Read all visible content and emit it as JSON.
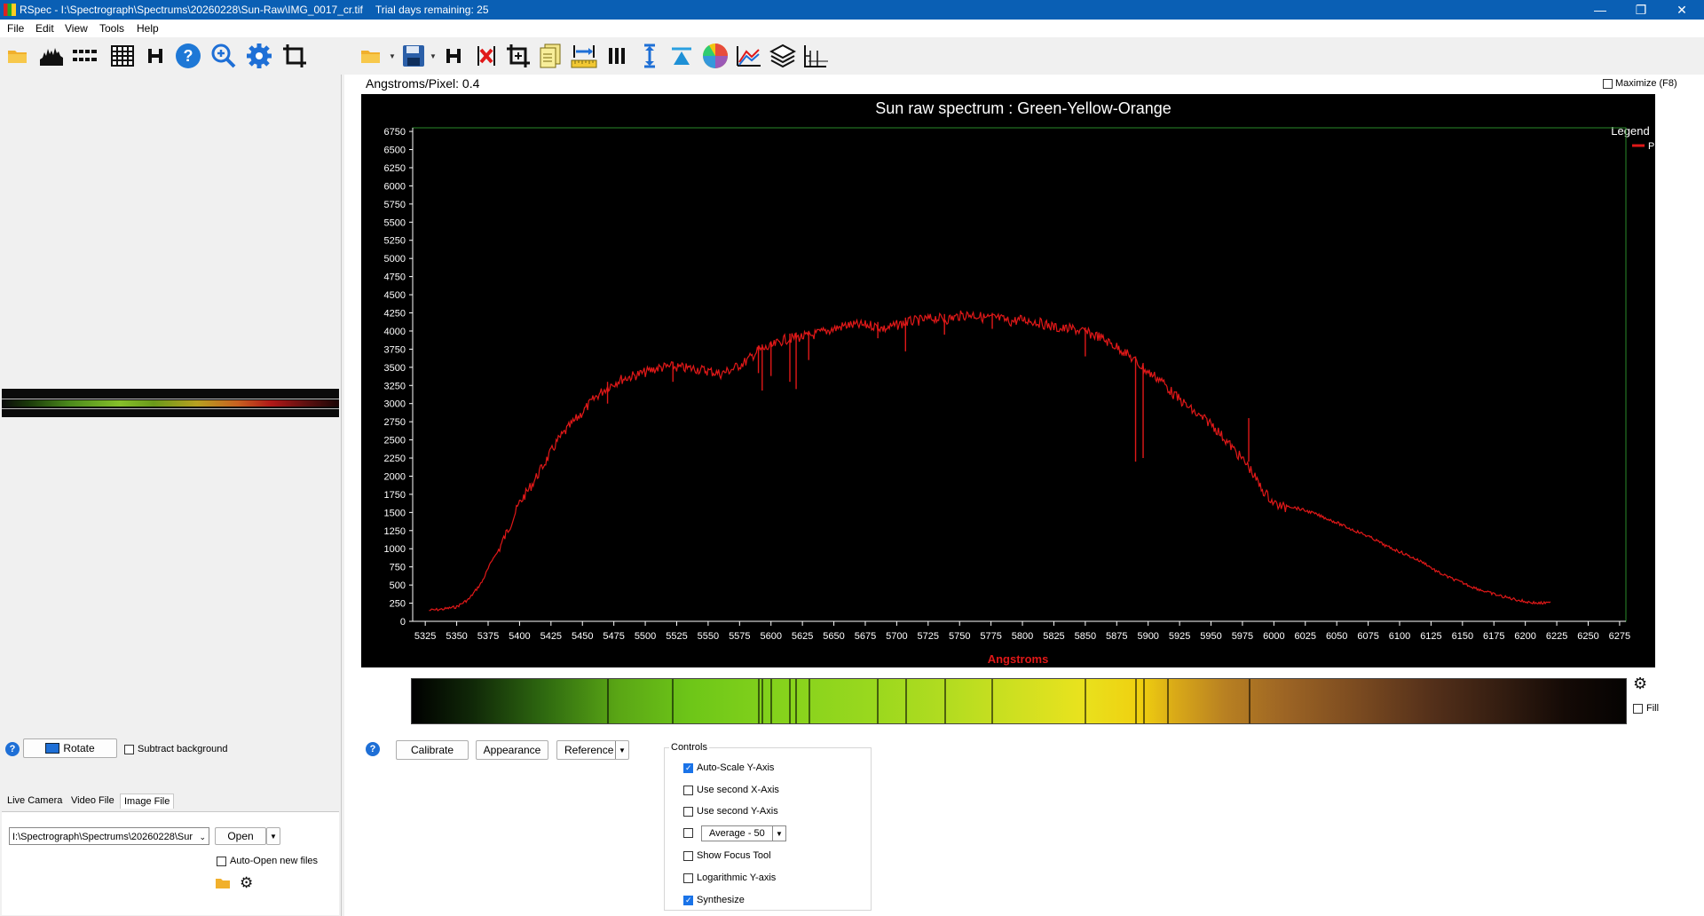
{
  "window": {
    "title": "RSpec - I:\\Spectrograph\\Spectrums\\20260228\\Sun-Raw\\IMG_0017_cr.tif",
    "trial_text": "Trial days remaining: 25",
    "minimize": "—",
    "restore": "❐",
    "close": "✕"
  },
  "menu": [
    "File",
    "Edit",
    "View",
    "Tools",
    "Help"
  ],
  "left_toolbar": [
    "open-folder-icon",
    "histogram-icon",
    "dotted-rows-icon",
    "grid-icon",
    "h-icon",
    "help-icon",
    "zoom-in-icon",
    "gear-icon",
    "crop-icon"
  ],
  "right_toolbar": [
    "open-folder-icon",
    "save-icon",
    "h-icon",
    "close-red-icon",
    "crop-icon",
    "notes-icon",
    "ruler-icon",
    "bars-icon",
    "vertical-measure-icon",
    "triangle-icon",
    "color-wheel-icon",
    "mountains-icon",
    "layers-icon",
    "axis-icon"
  ],
  "info": {
    "angstroms_per_pixel": "Angstroms/Pixel: 0.4",
    "maximize_label": "Maximize (F8)"
  },
  "left_panel": {
    "rotate_label": "Rotate",
    "subtract_background_label": "Subtract background",
    "tabs": [
      "Live Camera",
      "Video File",
      "Image File"
    ],
    "active_tab": "Image File",
    "path_value": "I:\\Spectrograph\\Spectrums\\20260228\\Sur",
    "open_label": "Open",
    "auto_open_label": "Auto-Open new files"
  },
  "bottom": {
    "calibrate_label": "Calibrate",
    "appearance_label": "Appearance",
    "reference_label": "Reference",
    "fill_label": "Fill",
    "controls_title": "Controls",
    "controls": [
      {
        "label": "Auto-Scale Y-Axis",
        "checked": true
      },
      {
        "label": "Use second X-Axis",
        "checked": false
      },
      {
        "label": "Use second Y-Axis",
        "checked": false
      },
      {
        "label": "Average - 50",
        "checked": false,
        "is_select": true
      },
      {
        "label": "Show Focus Tool",
        "checked": false
      },
      {
        "label": "Logarithmic Y-axis",
        "checked": false
      },
      {
        "label": "Synthesize",
        "checked": true
      }
    ]
  },
  "chart_data": {
    "type": "line",
    "title": "Sun raw spectrum : Green-Yellow-Orange",
    "xlabel": "Angstroms",
    "ylabel": "",
    "legend_title": "Legend",
    "legend_placement": "top-right",
    "xlim": [
      5315,
      6280
    ],
    "ylim": [
      0,
      6800
    ],
    "x_ticks": [
      5325,
      5350,
      5375,
      5400,
      5425,
      5450,
      5475,
      5500,
      5525,
      5550,
      5575,
      5600,
      5625,
      5650,
      5675,
      5700,
      5725,
      5750,
      5775,
      5800,
      5825,
      5850,
      5875,
      5900,
      5925,
      5950,
      5975,
      6000,
      6025,
      6050,
      6075,
      6100,
      6125,
      6150,
      6175,
      6200,
      6225,
      6250,
      6275
    ],
    "y_ticks": [
      0,
      250,
      500,
      750,
      1000,
      1250,
      1500,
      1750,
      2000,
      2250,
      2500,
      2750,
      3000,
      3250,
      3500,
      3750,
      4000,
      4250,
      4500,
      4750,
      5000,
      5250,
      5500,
      5750,
      6000,
      6250,
      6500,
      6750
    ],
    "colors": {
      "series": "#e01818",
      "frame": "#2a8a2a",
      "xlabel": "#e01818",
      "text": "#ffffff"
    },
    "series": [
      {
        "name": "Profile",
        "x": [
          5328,
          5340,
          5350,
          5360,
          5370,
          5380,
          5390,
          5400,
          5410,
          5420,
          5430,
          5440,
          5450,
          5460,
          5470,
          5480,
          5490,
          5500,
          5510,
          5520,
          5530,
          5540,
          5550,
          5560,
          5570,
          5580,
          5590,
          5600,
          5610,
          5620,
          5630,
          5640,
          5650,
          5660,
          5670,
          5680,
          5690,
          5700,
          5710,
          5720,
          5730,
          5740,
          5750,
          5760,
          5770,
          5780,
          5790,
          5800,
          5810,
          5820,
          5830,
          5840,
          5850,
          5860,
          5870,
          5880,
          5890,
          5900,
          5910,
          5920,
          5930,
          5940,
          5950,
          5960,
          5970,
          5980,
          5990,
          6000,
          6010,
          6020,
          6030,
          6040,
          6050,
          6060,
          6070,
          6080,
          6090,
          6100,
          6110,
          6120,
          6130,
          6140,
          6150,
          6160,
          6170,
          6180,
          6190,
          6200,
          6210,
          6220
        ],
        "y": [
          170,
          190,
          220,
          330,
          560,
          930,
          1300,
          1700,
          1960,
          2250,
          2550,
          2760,
          2950,
          3150,
          3300,
          3400,
          3450,
          3500,
          3560,
          3580,
          3560,
          3550,
          3520,
          3480,
          3550,
          3650,
          3800,
          3850,
          3950,
          3980,
          4000,
          4050,
          4100,
          4150,
          4150,
          4150,
          4100,
          4150,
          4200,
          4220,
          4250,
          4230,
          4280,
          4300,
          4250,
          4250,
          4200,
          4230,
          4200,
          4150,
          4100,
          4100,
          4050,
          4000,
          3900,
          3800,
          3650,
          3500,
          3400,
          3200,
          3050,
          2900,
          2800,
          2600,
          2400,
          2200,
          1900,
          1700,
          1620,
          1570,
          1520,
          1450,
          1380,
          1300,
          1230,
          1150,
          1050,
          980,
          900,
          820,
          700,
          620,
          550,
          480,
          420,
          370,
          330,
          290,
          270,
          270
        ]
      }
    ],
    "dips": [
      [
        5470,
        3000
      ],
      [
        5522,
        3300
      ],
      [
        5590,
        3420
      ],
      [
        5593,
        3180
      ],
      [
        5600,
        3380
      ],
      [
        5615,
        3300
      ],
      [
        5620,
        3200
      ],
      [
        5630,
        3600
      ],
      [
        5685,
        3900
      ],
      [
        5707,
        3720
      ],
      [
        5738,
        3950
      ],
      [
        5776,
        4030
      ],
      [
        5850,
        3650
      ],
      [
        5890,
        2200
      ],
      [
        5896,
        2250
      ],
      [
        5915,
        3300
      ],
      [
        5980,
        2800
      ]
    ]
  }
}
